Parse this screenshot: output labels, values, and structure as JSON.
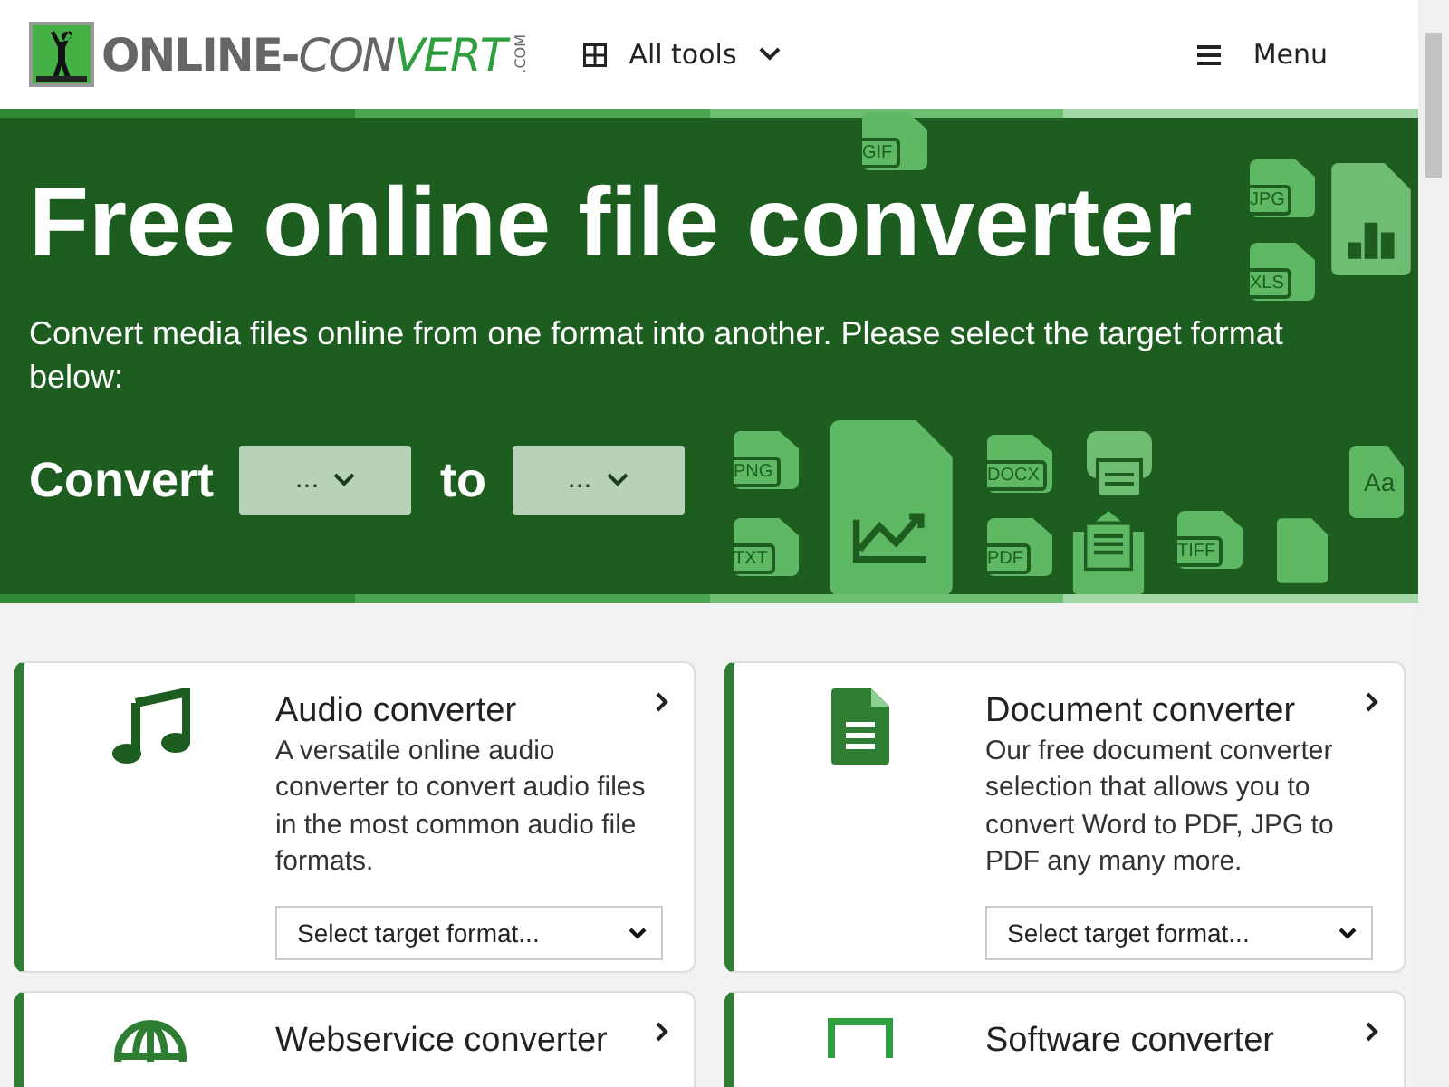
{
  "header": {
    "logo": {
      "parts": [
        {
          "kind": "plain",
          "text": "ONLINE-"
        },
        {
          "kind": "italic",
          "text": "CON"
        },
        {
          "kind": "accent",
          "text": "VERT"
        }
      ],
      "suffix": ".COM"
    },
    "all_tools": "All tools",
    "menu": "Menu"
  },
  "hero": {
    "title": "Free online file converter",
    "subtitle": "Convert media files online from one format into another. Please select the target format below:",
    "convert_label": "Convert",
    "to_label": "to",
    "from_select": "...",
    "to_select": "...",
    "file_labels": [
      "GIF",
      "JPG",
      "XLS",
      "TXT",
      "PDF",
      "PNG",
      "DOCX",
      "TIFF",
      "Aa"
    ]
  },
  "cards": [
    {
      "kind": "music",
      "title": "Audio converter",
      "description": "A versatile online audio converter to convert audio files in the most common audio file formats.",
      "select": "Select target format..."
    },
    {
      "kind": "document",
      "title": "Document converter",
      "description": "Our free document converter selection that allows you to convert Word to PDF, JPG to PDF any many more.",
      "select": "Select target format..."
    },
    {
      "kind": "globe",
      "title": "Webservice converter"
    },
    {
      "kind": "monitor",
      "title": "Software converter"
    }
  ]
}
